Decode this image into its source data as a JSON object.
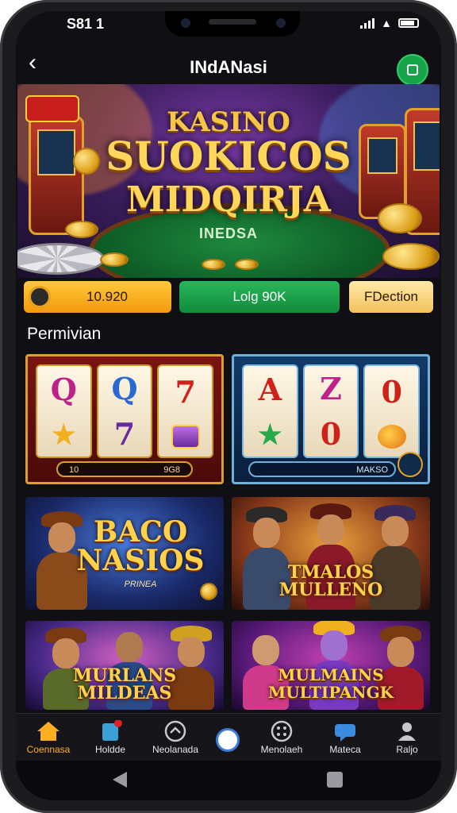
{
  "status_bar": {
    "time": "S81 1"
  },
  "header": {
    "title": "INdANasi"
  },
  "banner": {
    "badge": "",
    "line1": "KASINO",
    "line2": "SUOKICOS",
    "line3": "MIDQIRJA",
    "felt_text": "INEDSA"
  },
  "actions": {
    "balance": "10.920",
    "login": "Lolg 90K",
    "other": "FDection"
  },
  "section_title": "Permivian",
  "games": [
    {
      "type": "slot",
      "reels": [
        [
          "Q",
          "star"
        ],
        [
          "Q",
          "7"
        ],
        [
          "7",
          "gem"
        ]
      ],
      "bar_left": "10",
      "bar_right": "9G8"
    },
    {
      "type": "slot",
      "reels": [
        [
          "A",
          "star"
        ],
        [
          "Z",
          "0"
        ],
        [
          "0",
          "orb"
        ]
      ],
      "bar_left": "",
      "bar_right": "MAKSO"
    },
    {
      "type": "poster",
      "title": "BACO",
      "title2": "NASIOS",
      "sub": "PRINEA"
    },
    {
      "type": "poster",
      "title": "TMALOS",
      "title2": "MULLENO",
      "sub": ""
    },
    {
      "type": "poster",
      "title": "MURLANS",
      "title2": "MILDEAS",
      "sub": ""
    },
    {
      "type": "poster",
      "title": "MULMAINS",
      "title2": "MULTIPANGK",
      "sub": ""
    }
  ],
  "bottom_nav": {
    "items": [
      {
        "label": "Coennasa",
        "icon": "home-icon",
        "active": true
      },
      {
        "label": "Holdde",
        "icon": "gift-icon",
        "active": false
      },
      {
        "label": "Neolanada",
        "icon": "compass-icon",
        "active": false
      },
      {
        "label": "Menolaeh",
        "icon": "grid-icon",
        "active": false
      },
      {
        "label": "Mateca",
        "icon": "chat-icon",
        "active": false
      },
      {
        "label": "Raljo",
        "icon": "profile-icon",
        "active": false
      }
    ]
  },
  "colors": {
    "accent_gold": "#f6c54a",
    "login_green": "#138a3c",
    "active_nav": "#ffb020"
  }
}
